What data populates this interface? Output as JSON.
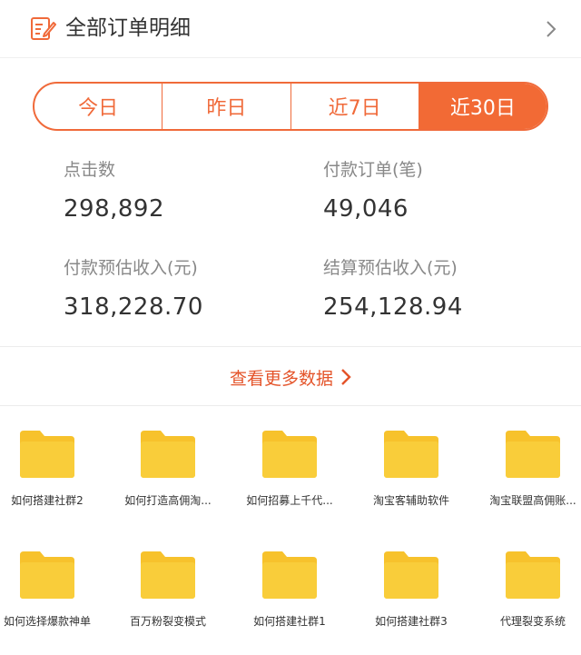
{
  "header": {
    "title": "全部订单明细",
    "icon": "document-edit-icon",
    "chevron": "chevron-right-icon"
  },
  "accent_color": "#f26a35",
  "folder_color": "#f7c22c",
  "tabs": [
    {
      "label": "今日",
      "active": false
    },
    {
      "label": "昨日",
      "active": false
    },
    {
      "label": "近7日",
      "active": false
    },
    {
      "label": "近30日",
      "active": true
    }
  ],
  "stats": [
    {
      "label": "点击数",
      "value": "298,892"
    },
    {
      "label": "付款订单(笔)",
      "value": "49,046"
    },
    {
      "label": "付款预估收入(元)",
      "value": "318,228.70"
    },
    {
      "label": "结算预估收入(元)",
      "value": "254,128.94"
    }
  ],
  "more_link": "查看更多数据",
  "folders": [
    "如何搭建社群2",
    "如何打造高佣淘...",
    "如何招募上千代...",
    "淘宝客辅助软件",
    "淘宝联盟高佣账...",
    "如何选择爆款神单",
    "百万粉裂变模式",
    "如何搭建社群1",
    "如何搭建社群3",
    "代理裂变系统"
  ]
}
